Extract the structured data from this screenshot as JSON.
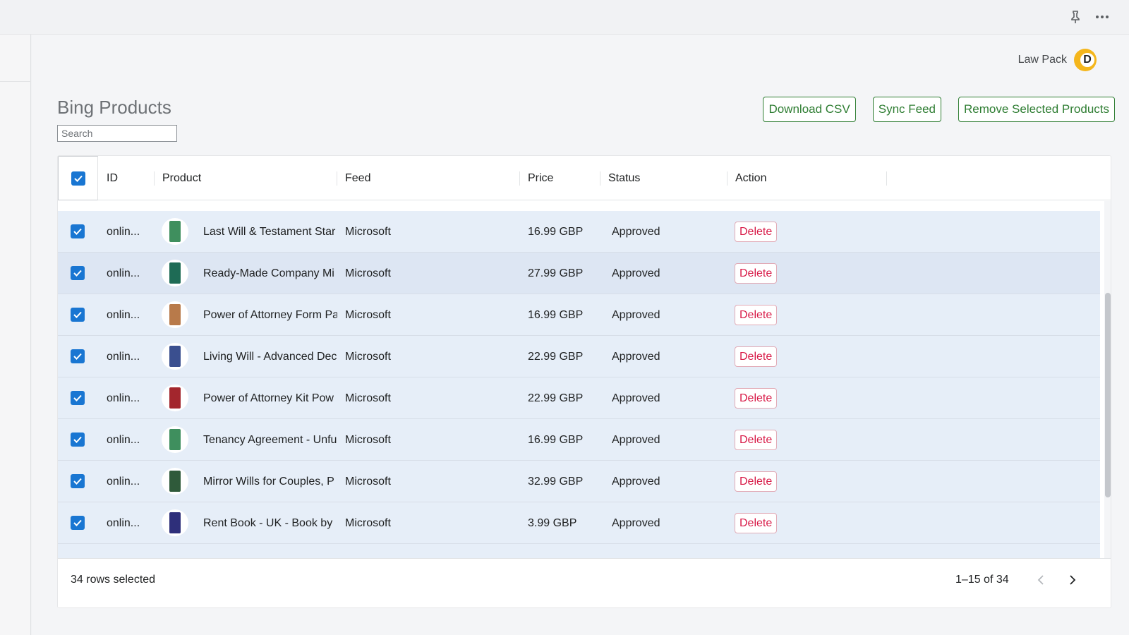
{
  "topbar": {
    "pin_icon": "pin-icon",
    "more_icon": "more-horizontal-icon"
  },
  "account": {
    "name": "Law Pack",
    "avatar_letter": "D"
  },
  "page": {
    "title": "Bing Products",
    "search_placeholder": "Search"
  },
  "actions": {
    "download_csv": "Download CSV",
    "sync_feed": "Sync Feed",
    "remove_selected": "Remove Selected Products"
  },
  "table": {
    "columns": [
      "ID",
      "Product",
      "Feed",
      "Price",
      "Status",
      "Action"
    ],
    "rows": [
      {
        "id": "onlin...",
        "product": "Last Will & Testament Star",
        "feed": "Microsoft",
        "price": "16.99 GBP",
        "status": "Approved",
        "action": "Delete",
        "thumb_color": "#3f8f5e"
      },
      {
        "id": "onlin...",
        "product": "Ready-Made Company Mi",
        "feed": "Microsoft",
        "price": "27.99 GBP",
        "status": "Approved",
        "action": "Delete",
        "thumb_color": "#1e6b55"
      },
      {
        "id": "onlin...",
        "product": "Power of Attorney Form Pa",
        "feed": "Microsoft",
        "price": "16.99 GBP",
        "status": "Approved",
        "action": "Delete",
        "thumb_color": "#b87a4a"
      },
      {
        "id": "onlin...",
        "product": "Living Will - Advanced Dec",
        "feed": "Microsoft",
        "price": "22.99 GBP",
        "status": "Approved",
        "action": "Delete",
        "thumb_color": "#3a4f8f"
      },
      {
        "id": "onlin...",
        "product": "Power of Attorney Kit Pow",
        "feed": "Microsoft",
        "price": "22.99 GBP",
        "status": "Approved",
        "action": "Delete",
        "thumb_color": "#a3262d"
      },
      {
        "id": "onlin...",
        "product": "Tenancy Agreement - Unfu",
        "feed": "Microsoft",
        "price": "16.99 GBP",
        "status": "Approved",
        "action": "Delete",
        "thumb_color": "#3f8f5e"
      },
      {
        "id": "onlin...",
        "product": "Mirror Wills for Couples, P",
        "feed": "Microsoft",
        "price": "32.99 GBP",
        "status": "Approved",
        "action": "Delete",
        "thumb_color": "#2f5a3a"
      },
      {
        "id": "onlin...",
        "product": "Rent Book - UK - Book by",
        "feed": "Microsoft",
        "price": "3.99 GBP",
        "status": "Approved",
        "action": "Delete",
        "thumb_color": "#2e2f7a"
      }
    ]
  },
  "footer": {
    "selected_text": "34 rows selected",
    "range_text": "1–15 of 34"
  },
  "colors": {
    "accent_green": "#2e7d32",
    "checkbox_blue": "#1976d2",
    "delete_red": "#d81b48",
    "row_selected": "#e6eef8"
  }
}
